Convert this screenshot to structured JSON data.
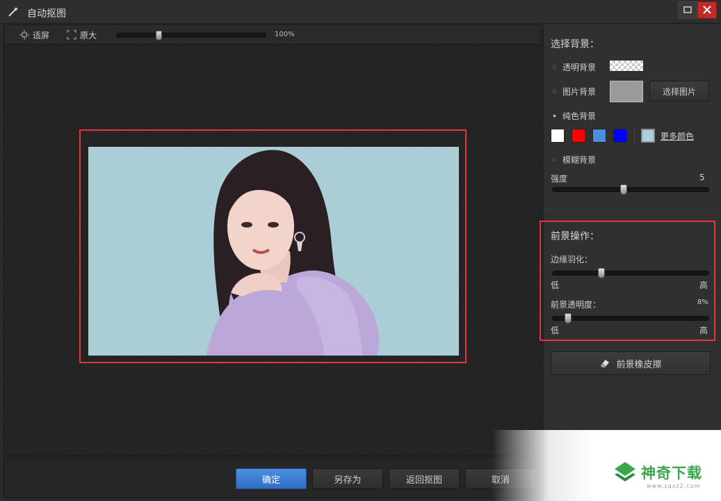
{
  "window": {
    "title": "自动抠图"
  },
  "toolbar": {
    "fit_label": "适屏",
    "original_label": "原大",
    "zoom_value": "100%",
    "zoom_fraction": 0.27
  },
  "actions": {
    "confirm": "确定",
    "save_as": "另存为",
    "back": "返回抠图",
    "cancel": "取消"
  },
  "background": {
    "heading": "选择背景：",
    "transparent": "透明背景",
    "image": "图片背景",
    "pick_image": "选择图片",
    "solid": "纯色背景",
    "selected": "solid",
    "colors": [
      "#ffffff",
      "#ff0000",
      "#4a90d9",
      "#0000ff"
    ],
    "current_color": "#a9cfe0",
    "more_colors": "更多颜色",
    "blur": "模糊背景",
    "strength_label": "强度",
    "strength_value": "5",
    "strength_fraction": 0.45
  },
  "foreground": {
    "heading": "前景操作：",
    "feather_label": "边缘羽化：",
    "feather_fraction": 0.3,
    "low": "低",
    "high": "高",
    "opacity_label": "前景透明度：",
    "opacity_value": "8%",
    "opacity_fraction": 0.08,
    "eraser": "前景橡皮擦"
  },
  "watermark": {
    "brand": "神奇下载",
    "url": "www.sqxz2.com"
  }
}
